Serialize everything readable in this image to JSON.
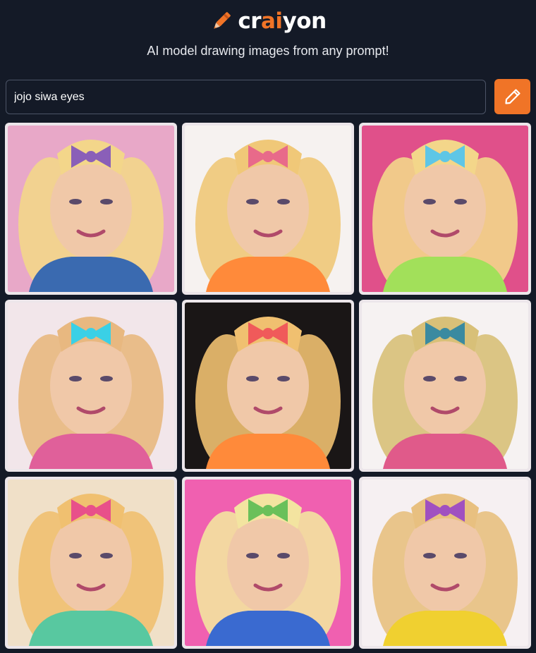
{
  "brand": {
    "logo_part1": "cr",
    "logo_part2": "ai",
    "logo_part3": "yon",
    "accent": "#f07427"
  },
  "tagline": "AI model drawing images from any prompt!",
  "search": {
    "value": "jojo siwa eyes",
    "button_icon": "pencil-icon"
  },
  "results": {
    "count_note": "",
    "images": [
      {
        "palette": [
          "#e8a8c8",
          "#f3d68a",
          "#8a5fb8",
          "#3a6ab0"
        ]
      },
      {
        "palette": [
          "#f6f2f0",
          "#f0c878",
          "#e86a8a",
          "#ff8a3a"
        ]
      },
      {
        "palette": [
          "#e0508a",
          "#f3d68a",
          "#5ec6e6",
          "#a2e05a"
        ]
      },
      {
        "palette": [
          "#f2e6ea",
          "#e8b880",
          "#3ad0e6",
          "#e0609a"
        ]
      },
      {
        "palette": [
          "#1a1616",
          "#f0c070",
          "#f05a5a",
          "#ff8a3a"
        ]
      },
      {
        "palette": [
          "#f6f2f2",
          "#d8c078",
          "#3a8aa0",
          "#e05a8a"
        ]
      },
      {
        "palette": [
          "#f0e0c8",
          "#f0c070",
          "#e8508a",
          "#58c8a0"
        ]
      },
      {
        "palette": [
          "#f060b0",
          "#f3e4a0",
          "#6ac05a",
          "#3a6ad0"
        ]
      },
      {
        "palette": [
          "#f6f0f2",
          "#e8c080",
          "#a050c0",
          "#f0d030"
        ]
      }
    ]
  }
}
